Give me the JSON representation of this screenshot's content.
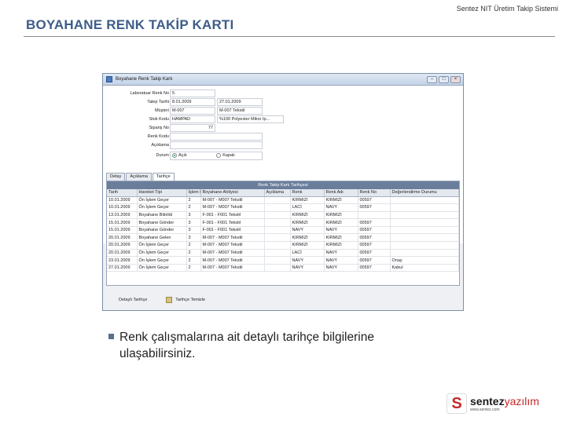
{
  "slide": {
    "title": "BOYAHANE RENK TAKİP KARTI",
    "header_right": "Sentez NIT Üretim Takip Sistemi",
    "bullet_text": "Renk çalışmalarına ait detaylı tarihçe bilgilerine ulaşabilirsiniz."
  },
  "window": {
    "title": "Boyahane Renk Takip Kartı",
    "form": [
      {
        "label": "Laboratuar Renk No",
        "value": "5",
        "value2": ""
      },
      {
        "label": "Talep Tarihi",
        "value": "8.01.2009",
        "value2": "27.01.2009"
      },
      {
        "label": "Müşteri",
        "value": "M-007",
        "value2": "M-007 Tekstil"
      },
      {
        "label": "Stok Kodu",
        "value": "HAMPAD",
        "value2": "%100 Polyester Mikro Ip..."
      },
      {
        "label": "Sipariş No",
        "value": "",
        "value2": "77"
      },
      {
        "label": "Renk Kodu",
        "value": "",
        "value2": ""
      },
      {
        "label": "Açıklama",
        "value": "",
        "value2": ""
      }
    ],
    "status_label": "Durum",
    "status_options": [
      "Açık",
      "Kapalı"
    ],
    "tabs": [
      "Detay",
      "Açıklama",
      "Tarihçe"
    ],
    "grid_caption": "Renk Takip Kartı Tarihçesi",
    "columns": [
      "Tarih",
      "Hareket Tipi",
      "İşlem No",
      "Boyahane Atölyesi",
      "Açıklama",
      "Renk",
      "Renk Adı",
      "Renk No",
      "Değerlendirme Durumu"
    ],
    "rows": [
      [
        "10.01.2009",
        "Ön İşlem Geçer",
        "2",
        "M-007 - M007 Tekstil",
        "",
        "KIRMIZI",
        "KIRMIZI",
        "00597",
        ""
      ],
      [
        "10.01.2009",
        "Ön İşlem Geçer",
        "2",
        "M-007 - M007 Tekstil",
        "",
        "LACİ",
        "NAVY",
        "00597",
        ""
      ],
      [
        "13.01.2009",
        "Boyahane Bitirildi",
        "3",
        "F-001 - F001 Tekstil",
        "",
        "KIRMIZI",
        "KIRMIZI",
        "",
        ""
      ],
      [
        "15.01.2009",
        "Boyahane Gönder",
        "3",
        "F-001 - F001 Tekstil",
        "",
        "KIRMIZI",
        "KIRMIZI",
        "00597",
        ""
      ],
      [
        "15.01.2009",
        "Boyahane Gönder",
        "3",
        "F-001 - F001 Tekstil",
        "",
        "NAVY",
        "NAVY",
        "00597",
        ""
      ],
      [
        "20.01.2009",
        "Boyahane Gelen",
        "3",
        "M-007 - M007 Tekstil",
        "",
        "KIRMIZI",
        "KIRMIZI",
        "00597",
        ""
      ],
      [
        "20.01.2009",
        "Ön İşlem Geçer",
        "2",
        "M-007 - M007 Tekstil",
        "",
        "KIRMIZI",
        "KIRMIZI",
        "00597",
        ""
      ],
      [
        "20.01.2009",
        "Ön İşlem Geçer",
        "2",
        "M-007 - M007 Tekstil",
        "",
        "LACİ",
        "NAVY",
        "00597",
        ""
      ],
      [
        "23.01.2009",
        "Ön İşlem Geçer",
        "2",
        "M-007 - M007 Tekstil",
        "",
        "NAVY",
        "NAVY",
        "00597",
        "Onay"
      ],
      [
        "27.01.2009",
        "Ön İşlem Geçer",
        "2",
        "M-007 - M007 Tekstil",
        "",
        "NAVY",
        "NAVY",
        "00597",
        "Kabul"
      ]
    ],
    "bottom_buttons": [
      "Detaylı Tarihçe",
      "Tarihçe Temizle"
    ]
  },
  "logo": {
    "brand_a": "sentez",
    "brand_b": "yazılım",
    "url": "www.sentez.com"
  },
  "colors": {
    "title": "#3d5d8a",
    "grid_caption": "#6a7e9c",
    "logo_red": "#c62828"
  }
}
